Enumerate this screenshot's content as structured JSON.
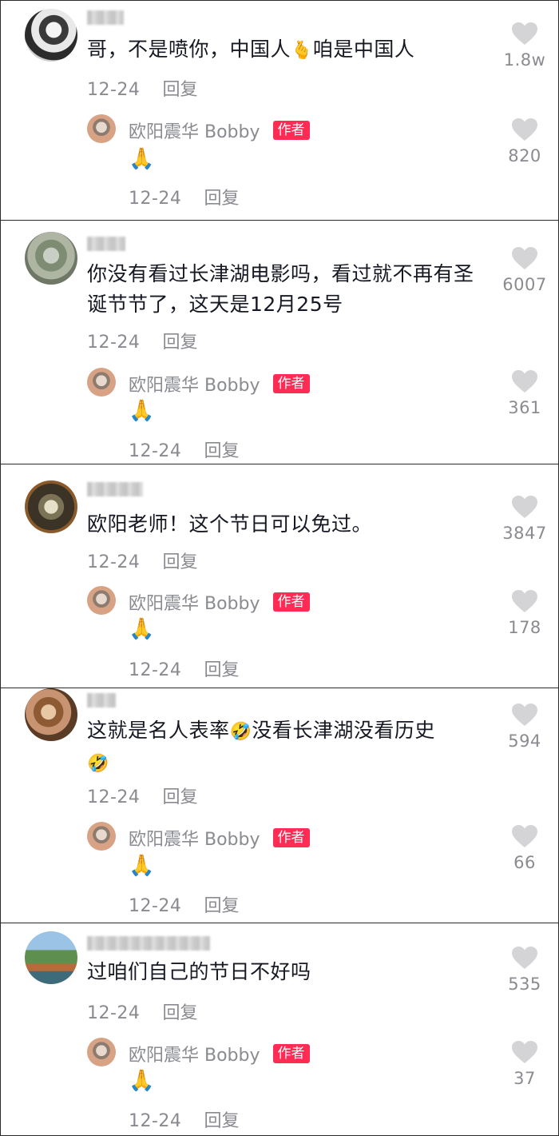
{
  "author": {
    "name": "欧阳震华 Bobby",
    "badge": "作者"
  },
  "icons": {
    "like": "heart-icon",
    "pray_emoji": "🙏",
    "love_emoji": "🫰",
    "laugh_emoji": "🤣"
  },
  "colors": {
    "badge": "#fe2c55",
    "meta": "#8a8b91",
    "heart": "#d4d4d6"
  },
  "comments": [
    {
      "text_a": "哥，不是喷你，中国人",
      "emoji": "🫰",
      "text_b": "咱是中国人",
      "date": "12-24",
      "reply_label": "回复",
      "likes": "1.8w",
      "reply": {
        "emoji": "🙏",
        "date": "12-24",
        "reply_label": "回复",
        "likes": "820"
      }
    },
    {
      "text": "你没有看过长津湖电影吗，看过就不再有圣诞节节了，这天是12月25号",
      "date": "12-24",
      "reply_label": "回复",
      "likes": "6007",
      "reply": {
        "emoji": "🙏",
        "date": "12-24",
        "reply_label": "回复",
        "likes": "361"
      }
    },
    {
      "text": "欧阳老师！这个节日可以免过。",
      "date": "12-24",
      "reply_label": "回复",
      "likes": "3847",
      "reply": {
        "emoji": "🙏",
        "date": "12-24",
        "reply_label": "回复",
        "likes": "178"
      }
    },
    {
      "text_a": "这就是名人表率",
      "emoji": "🤣",
      "text_b": "没看长津湖没看历史",
      "emoji_end": "🤣",
      "date": "12-24",
      "reply_label": "回复",
      "likes": "594",
      "reply": {
        "emoji": "🙏",
        "date": "12-24",
        "reply_label": "回复",
        "likes": "66"
      }
    },
    {
      "text": "过咱们自己的节日不好吗",
      "date": "12-24",
      "reply_label": "回复",
      "likes": "535",
      "reply": {
        "emoji": "🙏",
        "date": "12-24",
        "reply_label": "回复",
        "likes": "37"
      }
    }
  ]
}
